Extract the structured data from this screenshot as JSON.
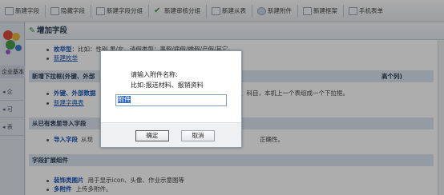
{
  "toolbar": {
    "items": [
      {
        "label": "新建字段",
        "icon": "new-field-icon"
      },
      {
        "label": "隐藏字段",
        "icon": "hide-field-icon"
      },
      {
        "label": "新建字段分组",
        "icon": "new-group-icon"
      },
      {
        "label": "新建审核分组",
        "icon": "check-icon"
      },
      {
        "label": "新建从表",
        "icon": "table-icon"
      },
      {
        "label": "新建附件",
        "icon": "attachment-icon"
      },
      {
        "label": "新建框架",
        "icon": "frame-icon"
      },
      {
        "label": "手机表单",
        "icon": "phone-icon"
      }
    ]
  },
  "left_panel": {
    "label": "企业基本",
    "items": [
      "企",
      "可",
      "表"
    ]
  },
  "main": {
    "title": "增加字段",
    "sections": [
      {
        "header": "",
        "rows": [
          {
            "link": "枚举型",
            "text": "：比如：性别 男/女、请假类型：事假/病假/婚假/产假/其它。"
          },
          {
            "link": "新建枚举",
            "text": "",
            "plain": true
          }
        ]
      },
      {
        "header": "新增下拉框(外键、外部",
        "header_tail": "高个列)",
        "rows": [
          {
            "link": "外键、外部数据",
            "text": "、科目，本机上一个表组成一个下拉框。"
          },
          {
            "link": "新建字典表",
            "text": "",
            "plain": true
          }
        ]
      },
      {
        "header": "从已有表里导入字段",
        "rows": [
          {
            "link": "导入字段",
            "text": "从现",
            "text_tail": "正确性。"
          }
        ]
      },
      {
        "header": "字段扩展组件",
        "rows": [
          {
            "link": "装饰类图片",
            "text": "用于显示icon、头像、作业示意图等"
          },
          {
            "link": "多附件",
            "text": "上传多附件。"
          }
        ]
      }
    ]
  },
  "dialog": {
    "prompt": "请输入附件名称:",
    "example": "比如:报送材料、报销资料",
    "input_value": "附件",
    "ok_label": "确定",
    "cancel_label": "取消"
  },
  "colors": {
    "link": "#1a56b5",
    "section_bg": "#dce5ef",
    "selection": "#316ac5"
  }
}
